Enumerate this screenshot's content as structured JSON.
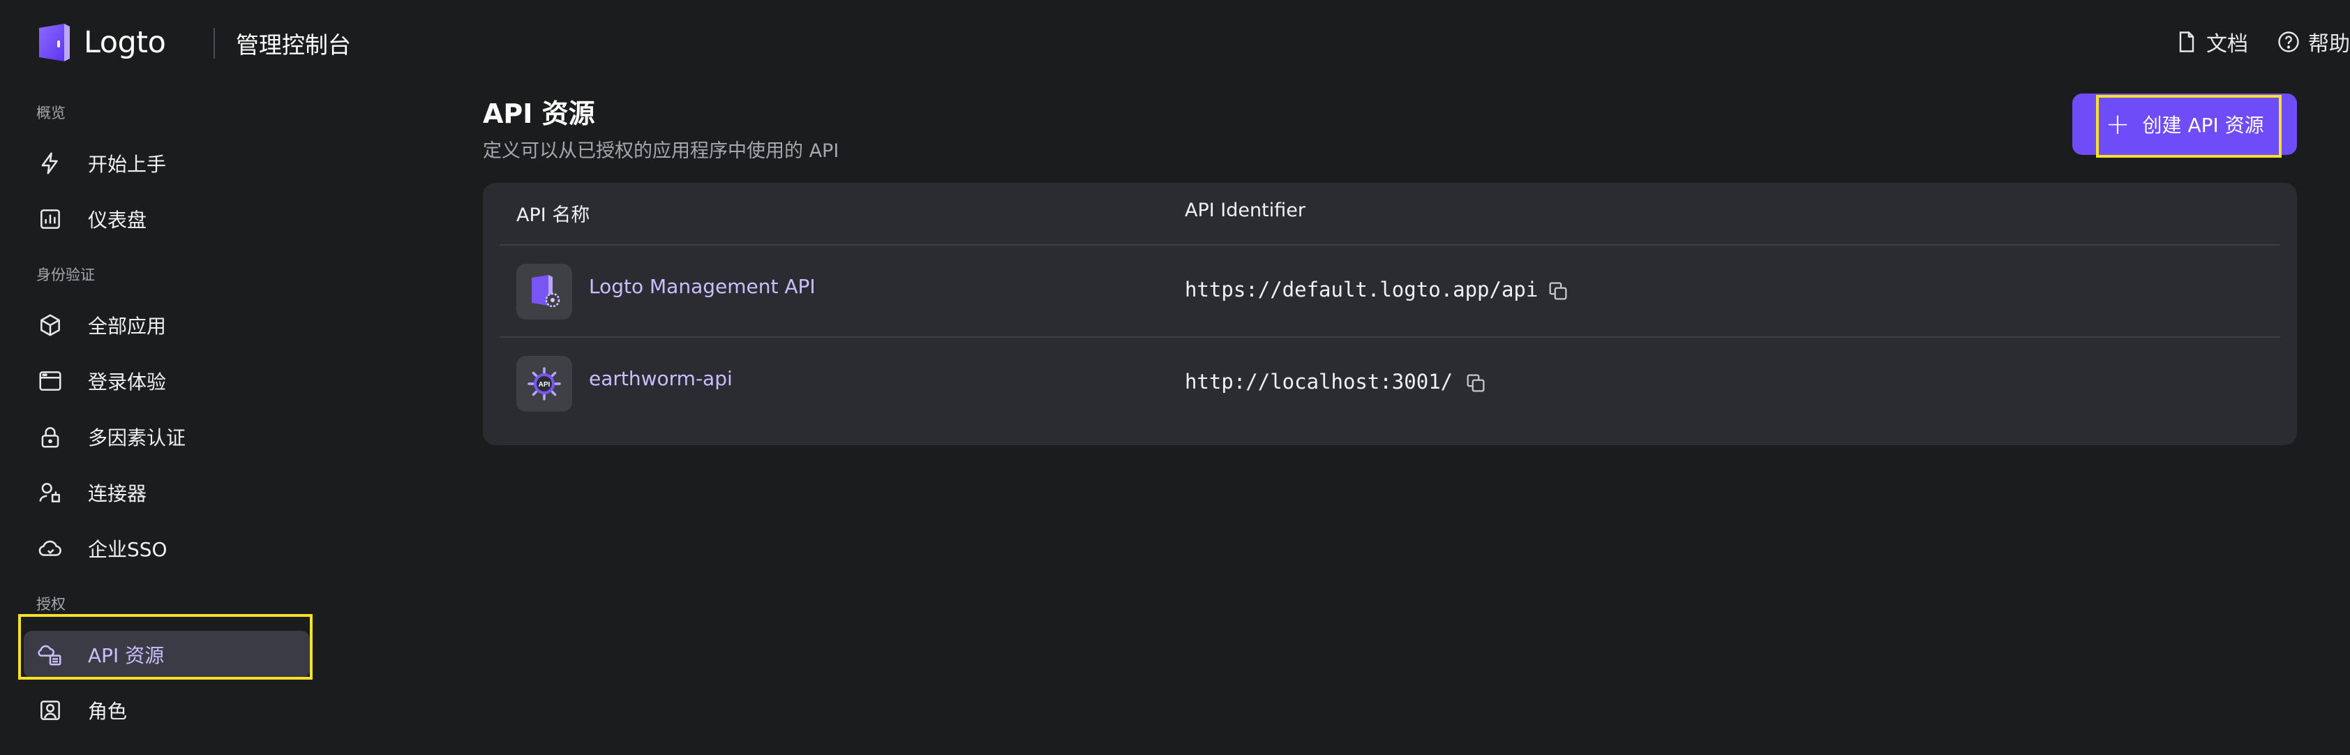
{
  "app": {
    "logo_text": "Logto",
    "console_title": "管理控制台"
  },
  "top_links": {
    "docs_label": "文档",
    "help_label": "帮助"
  },
  "sidebar": {
    "sections": {
      "overview": "概览",
      "identity": "身份验证",
      "authorization": "授权"
    },
    "items": [
      {
        "label": "开始上手",
        "icon": "lightning-icon"
      },
      {
        "label": "仪表盘",
        "icon": "chart-icon"
      },
      {
        "label": "全部应用",
        "icon": "cube-icon"
      },
      {
        "label": "登录体验",
        "icon": "browser-window-icon"
      },
      {
        "label": "多因素认证",
        "icon": "lock-icon"
      },
      {
        "label": "连接器",
        "icon": "connector-icon"
      },
      {
        "label": "企业SSO",
        "icon": "cloud-sso-icon"
      },
      {
        "label": "API 资源",
        "icon": "api-resource-icon",
        "active": true
      },
      {
        "label": "角色",
        "icon": "user-role-icon"
      }
    ]
  },
  "main": {
    "title": "API 资源",
    "subtitle": "定义可以从已授权的应用程序中使用的 API",
    "create_button": "创建 API 资源",
    "table": {
      "headers": {
        "name": "API 名称",
        "identifier": "API Identifier"
      },
      "rows": [
        {
          "name": "Logto Management API",
          "identifier": "https://default.logto.app/api",
          "icon": "logto-management-api-icon"
        },
        {
          "name": "earthworm-api",
          "identifier": "http://localhost:3001/",
          "icon": "api-gear-icon"
        }
      ]
    }
  },
  "colors": {
    "background": "#1a1c1d",
    "card": "#2a2c31",
    "accent": "#6e4cf7",
    "link": "#cabeff",
    "highlight": "#f5e12a"
  }
}
